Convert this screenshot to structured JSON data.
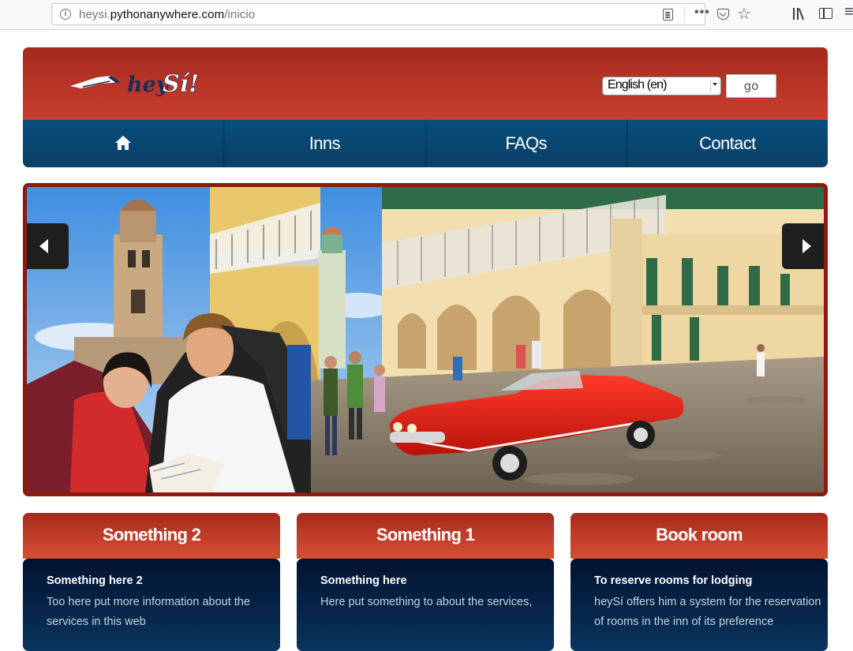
{
  "browser": {
    "url_prefix": "heysi.",
    "url_domain": "pythonanywhere.com",
    "url_path": "/inicio",
    "icons": [
      "info-icon",
      "reader-view-icon",
      "more-actions-icon",
      "pocket-icon",
      "bookmark-star-icon",
      "library-icon",
      "sidebar-icon",
      "menu-icon"
    ]
  },
  "header": {
    "logo_alt": "heySí!",
    "language_selected": "English (en)",
    "go_label": "go"
  },
  "nav": {
    "items": [
      {
        "label": "",
        "icon": "home-icon"
      },
      {
        "label": "Inns"
      },
      {
        "label": "FAQs"
      },
      {
        "label": "Contact"
      }
    ]
  },
  "slider": {
    "prev_icon": "chevron-left-icon",
    "next_icon": "chevron-right-icon"
  },
  "cards": [
    {
      "title": "Something 2",
      "subtitle": "Something here 2",
      "text": "Too here put more information about the services in this web"
    },
    {
      "title": "Something 1",
      "subtitle": "Something here",
      "text": "Here put something to about the services,"
    },
    {
      "title": "Book room",
      "subtitle": "To reserve rooms for lodging",
      "text": "heySí offers him a system for the reservation of rooms in the inn of its preference"
    }
  ],
  "colors": {
    "header_red": "#c0392b",
    "nav_blue": "#0b4670",
    "card_body_navy": "#06264a"
  }
}
